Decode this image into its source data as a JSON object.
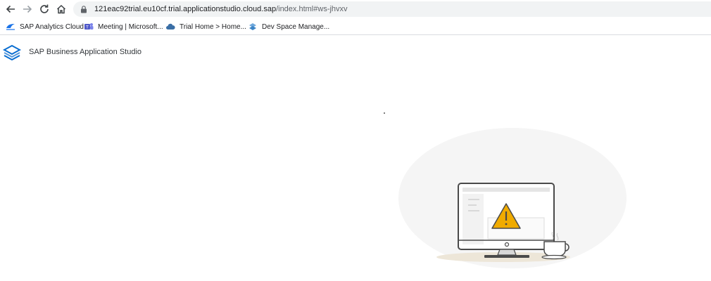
{
  "browser": {
    "url_host": "121eac92trial.eu10cf.trial.applicationstudio.cloud.sap",
    "url_path": "/index.html#ws-jhvxv"
  },
  "bookmarks": [
    {
      "label": "SAP Analytics Cloud",
      "icon": "sap-analytics-cloud-icon"
    },
    {
      "label": "Meeting | Microsoft...",
      "icon": "teams-icon"
    },
    {
      "label": "Trial Home > Home...",
      "icon": "cloud-icon"
    },
    {
      "label": "Dev Space Manage...",
      "icon": "bas-icon"
    }
  ],
  "app": {
    "title": "SAP Business Application Studio"
  },
  "colors": {
    "warning": "#f0ab00",
    "logo_blue": "#0a6ed1",
    "illustration_bg": "#f5f5f5"
  }
}
